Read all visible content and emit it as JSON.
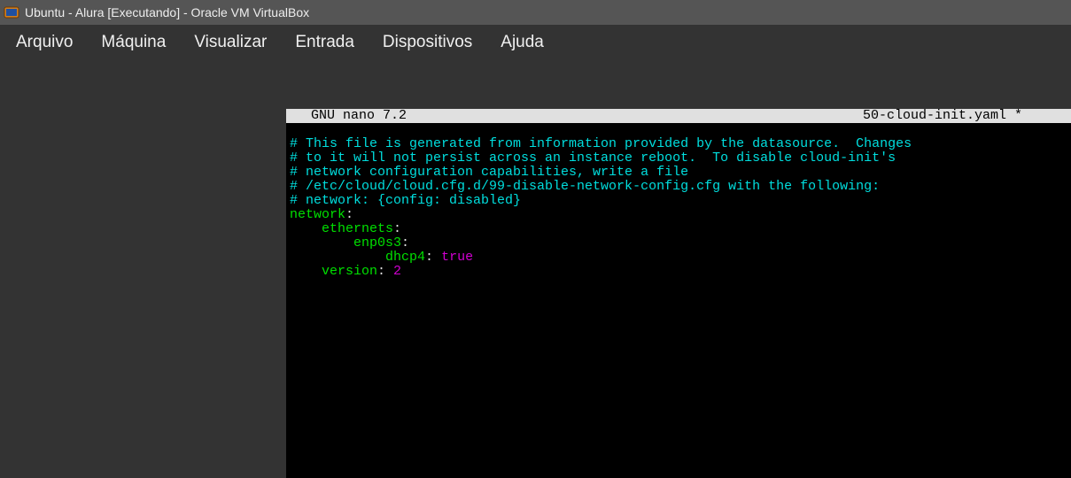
{
  "window": {
    "title": "Ubuntu - Alura [Executando] - Oracle VM VirtualBox"
  },
  "menu": {
    "arquivo": "Arquivo",
    "maquina": "Máquina",
    "visualizar": "Visualizar",
    "entrada": "Entrada",
    "dispositivos": "Dispositivos",
    "ajuda": "Ajuda"
  },
  "nano": {
    "headerLeft": "  GNU nano 7.2",
    "headerRight": "50-cloud-init.yaml *     ",
    "content": {
      "comment1": "# This file is generated from information provided by the datasource.  Changes",
      "comment2": "# to it will not persist across an instance reboot.  To disable cloud-init's",
      "comment3": "# network configuration capabilities, write a file",
      "comment4": "# /etc/cloud/cloud.cfg.d/99-disable-network-config.cfg with the following:",
      "comment5": "# network: {config: disabled}",
      "k_network": "network",
      "k_ethernets": "ethernets",
      "k_enp0s3": "enp0s3",
      "k_dhcp4": "dhcp4",
      "k_version": "version",
      "colon": ":",
      "v_true": " true",
      "v_two": " 2",
      "indent1": "    ",
      "indent2": "        ",
      "indent3": "            "
    }
  }
}
